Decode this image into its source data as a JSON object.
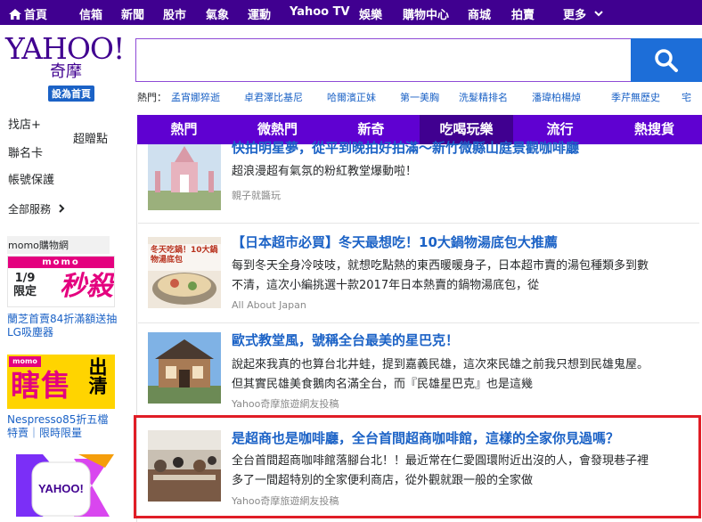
{
  "topnav": {
    "items": [
      "首頁",
      "信箱",
      "新聞",
      "股市",
      "氣象",
      "運動",
      "Yahoo TV",
      "娛樂",
      "購物中心",
      "商城",
      "拍賣",
      "更多"
    ]
  },
  "header": {
    "logo_text": "YAHOO!",
    "logo_cn": "奇摩",
    "set_home": "設為首頁",
    "search_placeholder": "",
    "trending_label": "熱門：",
    "trending": [
      "孟宵娜猝逝",
      "卓君澤比基尼",
      "哈爾濱正妹",
      "第一美胸",
      "洗髮精排名",
      "潘瑋柏楊焯",
      "季芹無歷史",
      "宅"
    ]
  },
  "sidebar": {
    "partial_top": [
      "找店+",
      "聯名卡",
      "帳號保護"
    ],
    "partial_top2": "超贈點",
    "all_services": "全部服務",
    "momo_title": "momo購物網",
    "ad1": {
      "brand": "momo",
      "date_line1": "1/9",
      "date_line2": "限定",
      "kill": "秒殺",
      "caption": "蘭芝首賣84折滿額送抽LG吸塵器"
    },
    "ad2": {
      "brand": "momo",
      "big": "瞎售",
      "side": "出清",
      "caption": "Nespresso85折五檔特賣｜限時限量"
    },
    "ad3": {
      "label": "YAHOO!"
    }
  },
  "tabs": {
    "items": [
      "熱門",
      "微熱門",
      "新奇",
      "吃喝玩樂",
      "流行",
      "熱搜貨"
    ],
    "active_index": 3
  },
  "feed": {
    "cards": [
      {
        "title": "快拍明星夢，從平到晚拍好拍滿～新竹微縣山庭景觀咖啡廳",
        "summary": "超浪漫超有氣氛的粉紅教堂爆動啦！",
        "source": "親子就醬玩"
      },
      {
        "title": "【日本超市必買】冬天最想吃！10大鍋物湯底包大推薦",
        "summary": "每到冬天全身冷吱吱，就想吃點熱的東西暖暖身子，日本超市賣的湯包種類多到數不清，這次小編挑選十款2017年日本熱賣的鍋物湯底包，從",
        "source": "All About Japan",
        "thumb_text": "冬天吃鍋！10大鍋物湯底包"
      },
      {
        "title": "歐式教堂風，號稱全台最美的星巴克！",
        "summary": "說起來我真的也算台北井蛙，提到嘉義民雄，這次來民雄之前我只想到民雄鬼屋。但其實民雄美食鵝肉名滿全台，而『民雄星巴克』也是這幾",
        "source": "Yahoo奇摩旅遊網友投稿"
      },
      {
        "title": "是超商也是咖啡廳，全台首間超商咖啡館，這樣的全家你見過嗎？",
        "summary": "全台首間超商咖啡館落腳台北！！最近常在仁愛圓環附近出沒的人，會發現巷子裡多了一間超特別的全家便利商店，從外觀就跟一般的全家做",
        "source": "Yahoo奇摩旅遊網友投稿"
      }
    ]
  },
  "colors": {
    "brand_purple": "#400090",
    "tab_purple": "#5f01d1",
    "link_blue": "#1b62c6",
    "highlight_red": "#e01d26"
  }
}
